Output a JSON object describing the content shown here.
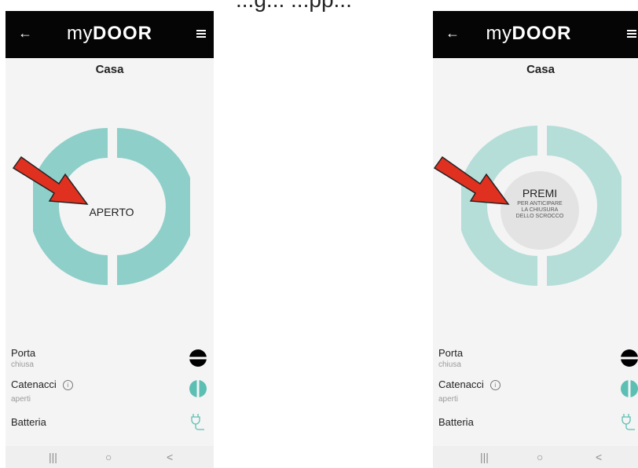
{
  "caption": "...g... ...pp...",
  "screens": [
    {
      "logo_my": "my",
      "logo_door": "DOOR",
      "back_icon": "←",
      "menu_icon": "hamburger-menu-icon",
      "title": "Casa",
      "ring_state": "APERTO",
      "ring_color": "#8ecfc9",
      "porta_label": "Porta",
      "porta_status": "chiusa",
      "catenacci_label": "Catenacci",
      "catenacci_info": "i",
      "catenacci_status": "aperti",
      "batteria_label": "Batteria",
      "nav_recent": "|||",
      "nav_home": "○",
      "nav_back": "<"
    },
    {
      "logo_my": "my",
      "logo_door": "DOOR",
      "back_icon": "←",
      "menu_icon": "hamburger-menu-icon",
      "title": "Casa",
      "ring_color": "#b5ded9",
      "button_title": "PREMI",
      "button_line1": "PER ANTICIPARE",
      "button_line2": "LA CHIUSURA",
      "button_line3": "DELLO SCROCCO",
      "porta_label": "Porta",
      "porta_status": "chiusa",
      "catenacci_label": "Catenacci",
      "catenacci_info": "i",
      "catenacci_status": "aperti",
      "batteria_label": "Batteria",
      "nav_recent": "|||",
      "nav_home": "○",
      "nav_back": "<"
    }
  ],
  "colors": {
    "arrow": "#e03020",
    "topbar": "#050505",
    "teal": "#8ecfc9",
    "teal_light": "#b5ded9"
  }
}
